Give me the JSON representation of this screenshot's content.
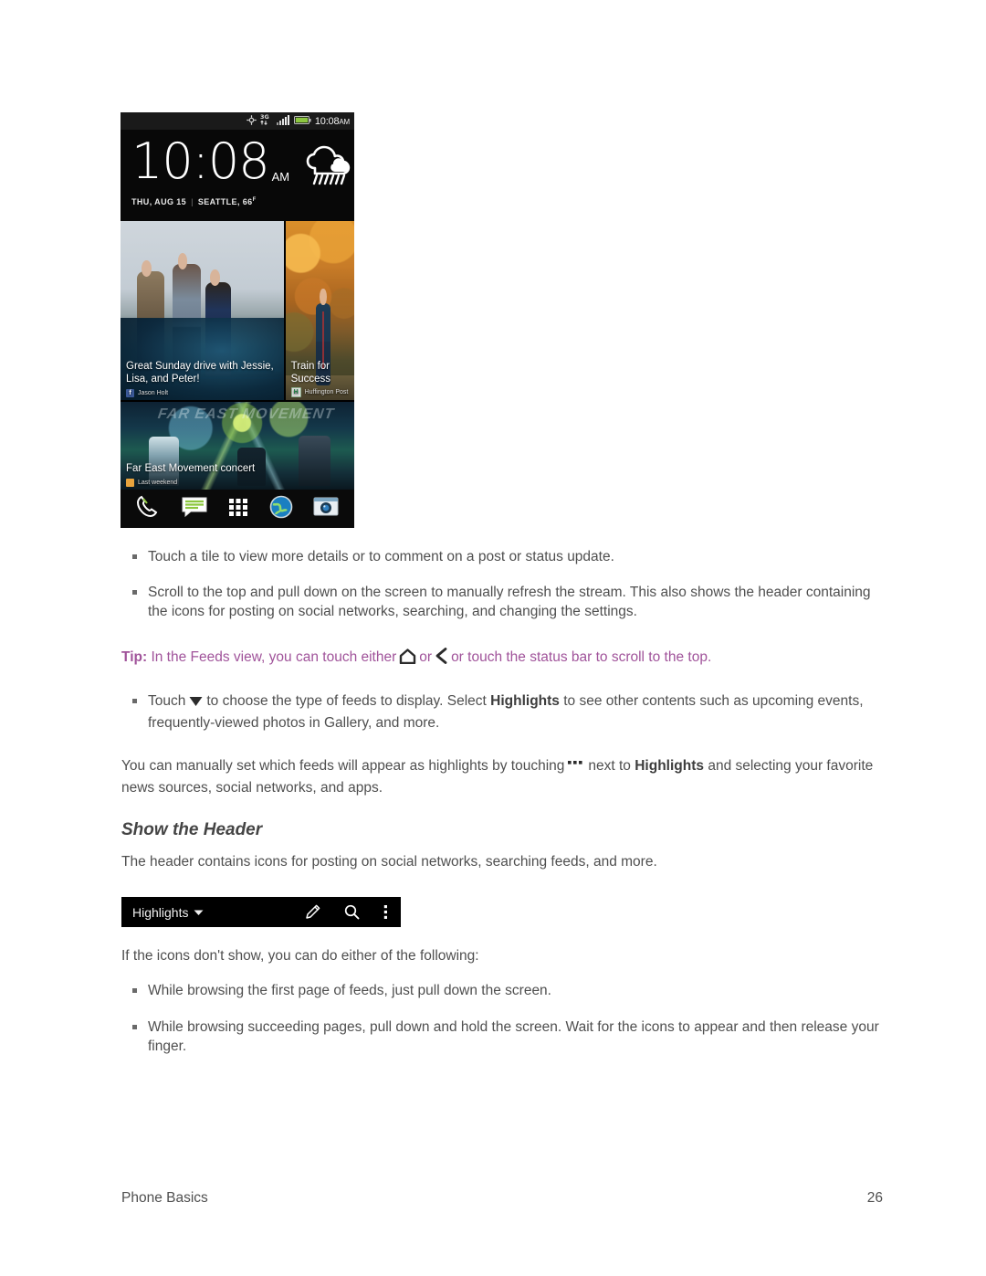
{
  "document": {
    "footer": {
      "section": "Phone Basics",
      "page_number": "26"
    }
  },
  "phone_screenshot": {
    "status_bar": {
      "icons": [
        "gps-icon",
        "3g-data-icon",
        "signal-bars-icon",
        "battery-icon"
      ],
      "network_label": "3G",
      "time": "10:08",
      "ampm": "AM"
    },
    "clock_widget": {
      "time": "10:08",
      "ampm": "AM",
      "date": "THU, AUG 15",
      "location": "SEATTLE, 66",
      "degree_unit": "F",
      "separator": "|",
      "weather_icon": "rain-cloud-icon"
    },
    "feed_tiles": [
      {
        "caption": "Great Sunday drive with Jessie, Lisa, and Peter!",
        "source": "Jason Holt",
        "source_badge": "facebook-icon",
        "badge_glyph": "f"
      },
      {
        "caption": "Train for Success",
        "source": "Huffington Post",
        "source_badge": "huffington-post-icon",
        "badge_glyph": "H"
      },
      {
        "caption": "Far East Movement concert",
        "source": "Last weekend",
        "source_badge": "calendar-icon",
        "badge_glyph": ""
      }
    ],
    "concert_art_text": "FAR EAST MOVEMENT",
    "dock": [
      "phone-icon",
      "messages-icon",
      "all-apps-icon",
      "browser-icon",
      "camera-icon"
    ]
  },
  "content": {
    "bullet_1": "Touch a tile to view more details or to comment on a post or status update.",
    "bullet_2": "Scroll to the top and pull down on the screen to manually refresh the stream. This also shows the header containing the icons for posting on social networks, searching, and changing the settings.",
    "tip": {
      "label": "Tip:",
      "part_1": "In the Feeds view, you can touch either",
      "icon_1": "home-icon",
      "part_2": "or",
      "icon_2": "back-icon",
      "part_3": "or touch the status bar to scroll to the top."
    },
    "bullet_3": {
      "part_1": "Touch",
      "icon": "dropdown-triangle-icon",
      "part_2": "to choose the type of feeds to display. Select",
      "bold_1": "Highlights",
      "part_3": "to see other contents such as upcoming events, frequently-viewed photos in Gallery, and more."
    },
    "paragraph_1": {
      "part_1": "You can manually set which feeds will appear as highlights by touching",
      "icon": "overflow-dots-icon",
      "part_2": "next to",
      "bold_1": "Highlights",
      "part_3": "and selecting your favorite news sources, social networks, and apps."
    },
    "section_heading": "Show the Header",
    "paragraph_2": "The header contains icons for posting on social networks, searching feeds, and more.",
    "paragraph_3": "If the icons don't show, you can do either of the following:",
    "bullet_4": "While browsing the first page of feeds, just pull down the screen.",
    "bullet_5": "While browsing succeeding pages, pull down and hold the screen. Wait for the icons to appear and then release your finger."
  },
  "header_bar_graphic": {
    "title": "Highlights",
    "caret_icon": "caret-down-icon",
    "icons": [
      "compose-pencil-icon",
      "search-icon",
      "overflow-menu-icon"
    ]
  },
  "colors": {
    "tip_text": "#a0539a",
    "body_text": "#4f4f4f",
    "heading_text": "#444444",
    "header_bar_bg": "#000000",
    "battery_green": "#8cc63f"
  }
}
